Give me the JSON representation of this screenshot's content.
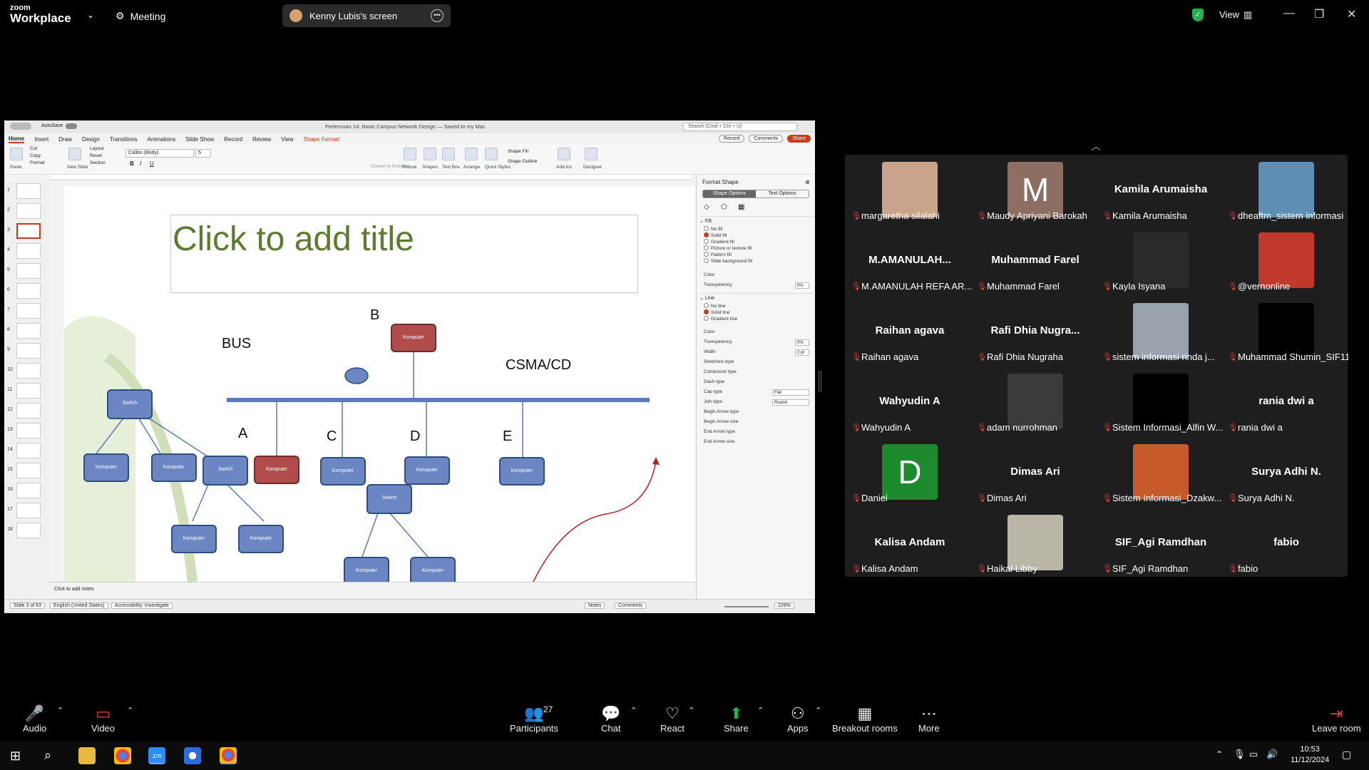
{
  "topbar": {
    "app_line1": "zoom",
    "app_line2": "Workplace",
    "meeting_label": "Meeting",
    "screen_label": "Kenny Lubis's screen",
    "view_label": "View"
  },
  "ppt": {
    "autosave": "AutoSave",
    "doc_title": "Pertemuan 14- Basic Campus Network Design — Saved to my Mac",
    "search": "Search (Cmd + Ctrl + U)",
    "tabs": [
      "Home",
      "Insert",
      "Draw",
      "Design",
      "Transitions",
      "Animations",
      "Slide Show",
      "Record",
      "Review",
      "View",
      "Shape Format"
    ],
    "record_btn": "Record",
    "comments_btn": "Comments",
    "share_btn": "Share",
    "font_name": "Calibri (Body)",
    "font_size": "5",
    "ribbon_labels": [
      "Paste",
      "New Slide",
      "Picture",
      "Shapes",
      "Text Box",
      "Arrange",
      "Quick Styles",
      "Add-ins",
      "Designer"
    ],
    "clipboard": [
      "Cut",
      "Copy",
      "Format"
    ],
    "slide_grp": [
      "Layout",
      "Reset",
      "Section"
    ],
    "shape_fill": "Shape Fill",
    "shape_outline": "Shape Outline",
    "convert": "Convert to SmartArt",
    "slide": {
      "title_placeholder": "Click to add title",
      "labels": {
        "b": "B",
        "bus": "BUS",
        "csma": "CSMA/CD",
        "a": "A",
        "c": "C",
        "d": "D",
        "e": "E"
      },
      "switch": "Switch",
      "komputer": "Komputer"
    },
    "notes": "Click to add notes",
    "status": {
      "slide_of": "Slide 3 of 63",
      "lang": "English (United States)",
      "access": "Accessibility: Investigate",
      "notes": "Notes",
      "comments": "Comments",
      "zoom": "229%"
    },
    "format_pane": {
      "title": "Format Shape",
      "tab1": "Shape Options",
      "tab2": "Text Options",
      "fill_header": "Fill",
      "fill_opts": [
        "No fill",
        "Solid fill",
        "Gradient fill",
        "Picture or texture fill",
        "Pattern fill",
        "Slide background fill"
      ],
      "color": "Color",
      "transparency": "Transparency",
      "trans_val": "0%",
      "line_header": "Line",
      "line_opts": [
        "No line",
        "Solid line",
        "Gradient line"
      ],
      "color2": "Color",
      "transparency2": "Transparency",
      "trans_val2": "0%",
      "width": "Width",
      "width_val": "2 pt",
      "sketched": "Sketched style",
      "compound": "Compound type",
      "dash": "Dash type",
      "cap": "Cap type",
      "cap_val": "Flat",
      "join": "Join type",
      "join_val": "Round",
      "begin_type": "Begin Arrow type",
      "begin_size": "Begin Arrow size",
      "end_type": "End Arrow type",
      "end_size": "End Arrow size"
    }
  },
  "participants": [
    {
      "name": "margaretha silalahi",
      "display": "",
      "kind": "photo",
      "color": "#c9a48a"
    },
    {
      "name": "Maudy Apriyani Barokah",
      "display": "M",
      "kind": "letter",
      "color": "#8d6e63"
    },
    {
      "name": "Kamila Arumaisha",
      "display": "Kamila Arumaisha",
      "kind": "text"
    },
    {
      "name": "dheaftm_sistem informasi",
      "display": "",
      "kind": "photo",
      "color": "#5d8fb5"
    },
    {
      "name": "M.AMANULAH REFA AR...",
      "display": "M.AMANULAH...",
      "kind": "text"
    },
    {
      "name": "Muhammad Farel",
      "display": "Muhammad Farel",
      "kind": "text"
    },
    {
      "name": "Kayla Isyana",
      "display": "",
      "kind": "photo",
      "color": "#2a2a2a"
    },
    {
      "name": "@vernonline",
      "display": "",
      "kind": "photo",
      "color": "#c0392b"
    },
    {
      "name": "Raihan agava",
      "display": "Raihan agava",
      "kind": "text"
    },
    {
      "name": "Rafi Dhia Nugraha",
      "display": "Rafi Dhia Nugra...",
      "kind": "text"
    },
    {
      "name": "sistem informasi rinda j...",
      "display": "",
      "kind": "photo",
      "color": "#9aa3ad"
    },
    {
      "name": "Muhammad Shumin_SIF11",
      "display": "",
      "kind": "photo",
      "color": "#000000"
    },
    {
      "name": "Wahyudin A",
      "display": "Wahyudin A",
      "kind": "text"
    },
    {
      "name": "adam nurrohman",
      "display": "",
      "kind": "photo",
      "color": "#3b3b3b"
    },
    {
      "name": "Sistem Informasi_Alfin W...",
      "display": "",
      "kind": "photo",
      "color": "#000000"
    },
    {
      "name": "rania dwi a",
      "display": "rania dwi a",
      "kind": "text"
    },
    {
      "name": "Daniel",
      "display": "D",
      "kind": "letter",
      "color": "#1e8a2e"
    },
    {
      "name": "Dimas Ari",
      "display": "Dimas Ari",
      "kind": "text"
    },
    {
      "name": "Sistem Informasi_Dzakw...",
      "display": "",
      "kind": "photo",
      "color": "#c75a2a"
    },
    {
      "name": "Surya Adhi N.",
      "display": "Surya Adhi N.",
      "kind": "text"
    },
    {
      "name": "Kalisa Andam",
      "display": "Kalisa Andam",
      "kind": "text"
    },
    {
      "name": "Haikal Libby",
      "display": "",
      "kind": "photo",
      "color": "#b9b6a8"
    },
    {
      "name": "SIF_Agi Ramdhan",
      "display": "SIF_Agi Ramdhan",
      "kind": "text"
    },
    {
      "name": "fabio",
      "display": "fabio",
      "kind": "text"
    }
  ],
  "bottombar": {
    "audio": "Audio",
    "video": "Video",
    "participants": "Participants",
    "participants_count": "27",
    "chat": "Chat",
    "react": "React",
    "share": "Share",
    "apps": "Apps",
    "breakout": "Breakout rooms",
    "more": "More",
    "leave": "Leave room"
  },
  "taskbar": {
    "time": "10:53",
    "date": "11/12/2024"
  },
  "colors": {
    "share_green": "#23b14d",
    "muted_red": "#e04040",
    "ppt_accent": "#c43e1c"
  }
}
